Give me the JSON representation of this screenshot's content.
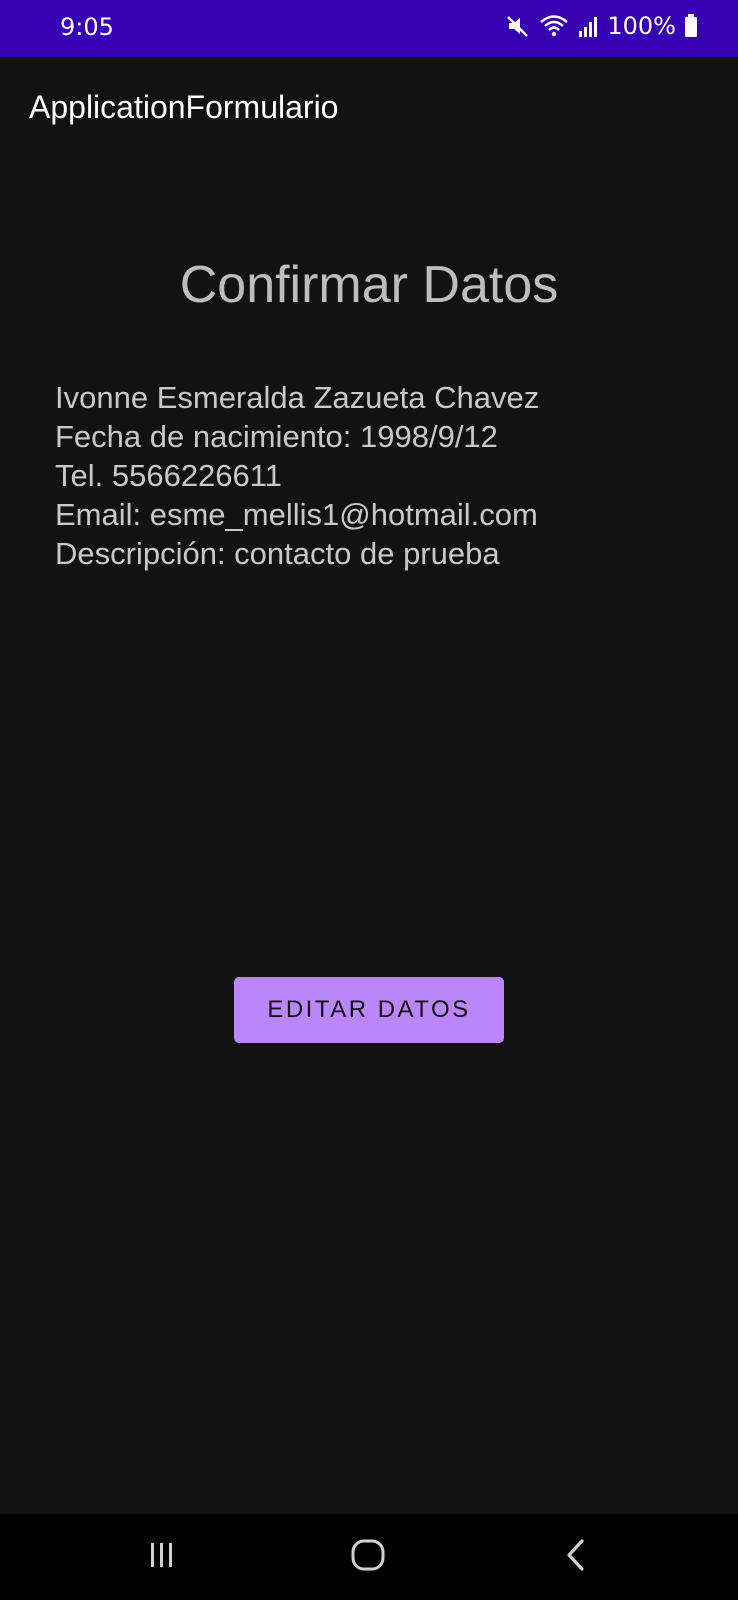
{
  "status_bar": {
    "time": "9:05",
    "battery": "100%",
    "icons": [
      "mute-icon",
      "wifi-icon",
      "signal-icon",
      "battery-icon"
    ]
  },
  "app_bar": {
    "title": "ApplicationFormulario"
  },
  "screen": {
    "title": "Confirmar Datos",
    "details": [
      "Ivonne Esmeralda Zazueta Chavez",
      "Fecha de nacimiento: 1998/9/12",
      "Tel. 5566226611",
      "Email: esme_mellis1@hotmail.com",
      "Descripción: contacto de prueba"
    ],
    "edit_button_label": "EDITAR DATOS"
  },
  "colors": {
    "status_bar": "#3700b3",
    "background": "#121212",
    "button": "#bb86fc"
  },
  "nav_bar": {
    "icons": [
      "recents-icon",
      "home-icon",
      "back-icon"
    ]
  }
}
